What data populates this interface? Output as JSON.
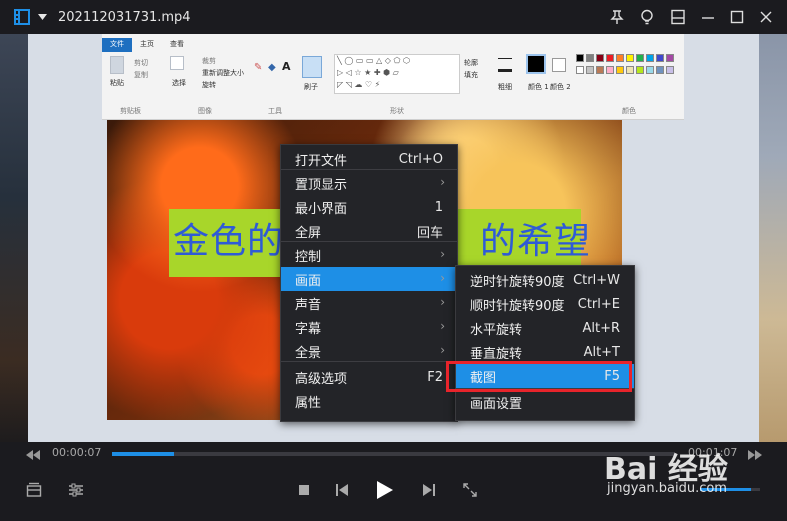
{
  "window": {
    "title": "202112031731.mp4"
  },
  "paint": {
    "tabs": [
      "文件",
      "主页",
      "查看"
    ],
    "groups": [
      "剪贴板",
      "图像",
      "工具",
      "形状",
      "颜色"
    ],
    "items": {
      "paste": "粘贴",
      "cut": "剪切",
      "copy": "复制",
      "select": "选择",
      "crop": "裁剪",
      "resize": "重新调整大小",
      "rotate": "旋转",
      "brush": "刷子",
      "outline": "轮廓",
      "fill": "填充",
      "thickness": "粗细",
      "color1": "颜色 1",
      "color2": "颜色 2"
    },
    "swatches": [
      "#000000",
      "#7f7f7f",
      "#880015",
      "#ed1c24",
      "#ff7f27",
      "#fff200",
      "#22b14c",
      "#00a2e8",
      "#3f48cc",
      "#a349a4",
      "#ffffff",
      "#c3c3c3",
      "#b97a57",
      "#ffaec9",
      "#ffc90e",
      "#efe4b0",
      "#b5e61d",
      "#99d9ea",
      "#7092be",
      "#c8bfe7"
    ]
  },
  "video": {
    "caption_left": "金色的",
    "caption_right": "的希望"
  },
  "context_menu": {
    "items": [
      {
        "label": "打开文件",
        "shortcut": "Ctrl+O",
        "arrow": ""
      },
      {
        "label": "置顶显示",
        "shortcut": "",
        "arrow": "›"
      },
      {
        "label": "最小界面",
        "shortcut": "1",
        "arrow": ""
      },
      {
        "label": "全屏",
        "shortcut": "回车",
        "arrow": ""
      },
      {
        "label": "控制",
        "shortcut": "",
        "arrow": "›"
      },
      {
        "label": "画面",
        "shortcut": "",
        "arrow": "›"
      },
      {
        "label": "声音",
        "shortcut": "",
        "arrow": "›"
      },
      {
        "label": "字幕",
        "shortcut": "",
        "arrow": "›"
      },
      {
        "label": "全景",
        "shortcut": "",
        "arrow": "›"
      },
      {
        "label": "高级选项",
        "shortcut": "F2",
        "arrow": ""
      },
      {
        "label": "属性",
        "shortcut": "",
        "arrow": ""
      }
    ],
    "highlighted_index": 5
  },
  "submenu": {
    "items": [
      {
        "label": "逆时针旋转90度",
        "shortcut": "Ctrl+W"
      },
      {
        "label": "顺时针旋转90度",
        "shortcut": "Ctrl+E"
      },
      {
        "label": "水平旋转",
        "shortcut": "Alt+R"
      },
      {
        "label": "垂直旋转",
        "shortcut": "Alt+T"
      },
      {
        "label": "截图",
        "shortcut": "F5"
      },
      {
        "label": "画面设置",
        "shortcut": ""
      }
    ],
    "highlighted_index": 4
  },
  "player": {
    "current_time": "00:00:07",
    "total_time": "00:01:07",
    "progress": 0.11,
    "volume": 0.85
  },
  "watermark": {
    "logo": "Bai 经验",
    "url": "jingyan.baidu.com"
  },
  "colors": {
    "accent": "#1e8fe6",
    "highlight_box": "#e8242b",
    "menu_bg": "#232428"
  }
}
